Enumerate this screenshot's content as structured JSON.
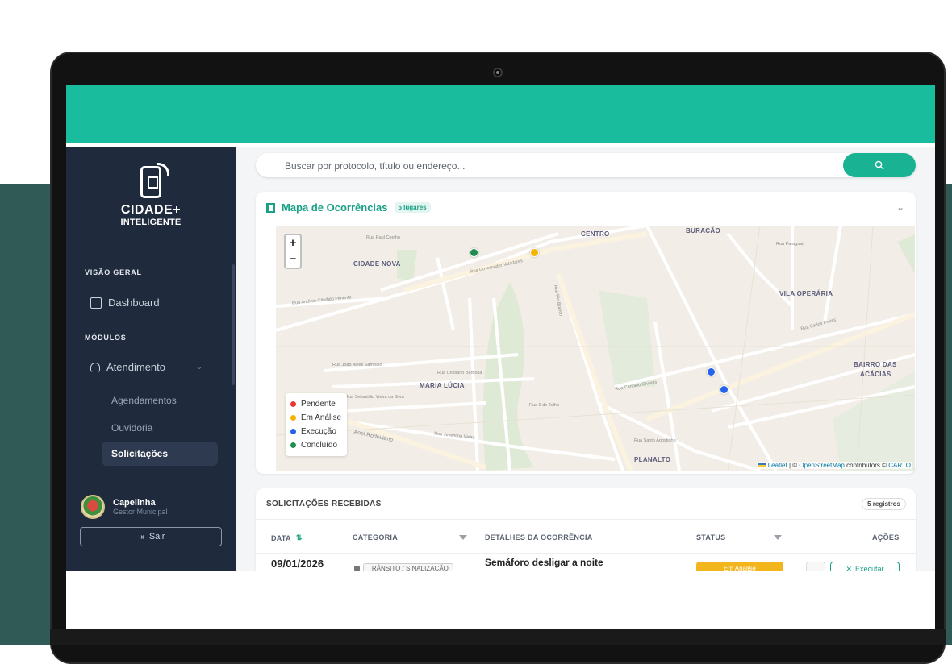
{
  "brand": {
    "line1": "CIDADE+",
    "line2": "INTELIGENTE"
  },
  "sidebar": {
    "section_overview": "VISÃO GERAL",
    "dashboard": "Dashboard",
    "section_modules": "MÓDULOS",
    "atendimento": "Atendimento",
    "sub_items": [
      {
        "label": "Agendamentos"
      },
      {
        "label": "Ouvidoria"
      },
      {
        "label": "Solicitações",
        "active": true
      }
    ],
    "user": {
      "name": "Capelinha",
      "role": "Gestor Municipal"
    },
    "logout": "Sair"
  },
  "search": {
    "placeholder": "Buscar por protocolo, título ou endereço...",
    "icon": "search-icon"
  },
  "map": {
    "title": "Mapa de Ocorrências",
    "badge": "5 lugares",
    "zoom_in": "+",
    "zoom_out": "−",
    "neighborhoods": [
      "CENTRO",
      "BURACÃO",
      "CIDADE NOVA",
      "VILA OPERÁRIA",
      "BAIRRO DAS",
      "ACÁCIAS",
      "MARIA LÚCIA",
      "PLANALTO"
    ],
    "streets": [
      "Rua Raul Coelho",
      "Rua Governador Valadares",
      "Rua Rio Branco",
      "Rua Carlos Prates",
      "Rua Antônio Cândido Pimenta",
      "Rua João Alves Sampaio",
      "Rua Cristiano Barbosa",
      "Rua Juventino Vieira",
      "Anel Rodoviário",
      "Rua Santo Agostinho",
      "Rua Sebastião Vieira da Silva",
      "Rua Paraguai",
      "Rua Carmelo Chaves",
      "Rua 9 de Julho"
    ],
    "legend": [
      {
        "label": "Pendente",
        "color": "#e53935"
      },
      {
        "label": "Em Análise",
        "color": "#f5b400"
      },
      {
        "label": "Execução",
        "color": "#2563eb"
      },
      {
        "label": "Concluído",
        "color": "#1e8e50"
      }
    ],
    "attribution": {
      "leaflet": "Leaflet",
      "sep": "| ©",
      "osm": "OpenStreetMap",
      "contrib": "contributors ©",
      "carto": "CARTO"
    }
  },
  "table": {
    "title": "SOLICITAÇÕES RECEBIDAS",
    "count": "5 registros",
    "headers": {
      "date": "DATA",
      "category": "CATEGORIA",
      "details": "DETALHES DA OCORRÊNCIA",
      "status": "STATUS",
      "actions": "AÇÕES"
    },
    "rows": [
      {
        "date": "09/01/2026",
        "category": "TRÂNSITO / SINALIZAÇÃO",
        "details": "Semáforo desligar a noite",
        "status": "Em Análise",
        "action": "Executar"
      }
    ]
  },
  "colors": {
    "accent": "#19bc9c",
    "sidebar": "#1f2a3c",
    "background_panel": "#2f5a56"
  }
}
